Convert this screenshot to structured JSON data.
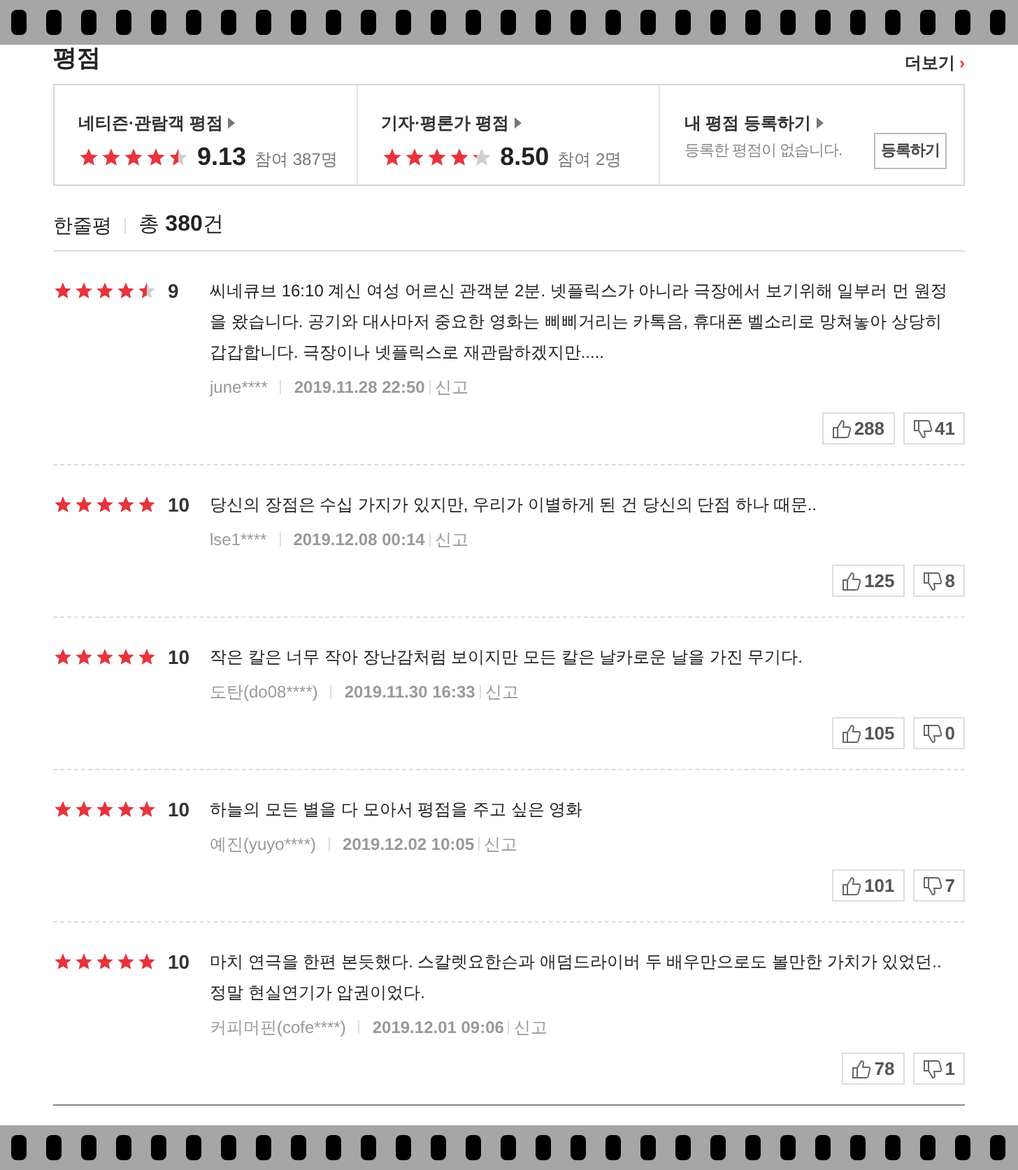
{
  "section_title": "평점",
  "more_link": "더보기",
  "more_arrow": "›",
  "summary": [
    {
      "kind": "score",
      "label": "네티즌·관람객 평점",
      "stars": 4.5,
      "score": "9.13",
      "participants": "참여 387명"
    },
    {
      "kind": "score",
      "label": "기자·평론가 평점",
      "stars": 4.25,
      "score": "8.50",
      "participants": "참여 2명"
    },
    {
      "kind": "register",
      "label": "내 평점 등록하기",
      "message": "등록한 평점이 없습니다.",
      "button": "등록하기"
    }
  ],
  "reviews_header": {
    "title": "한줄평",
    "total_prefix": "총",
    "total_count": "380",
    "total_suffix": "건"
  },
  "reviews": [
    {
      "stars": 4.5,
      "score": "9",
      "text": "씨네큐브 16:10 계신 여성 어르신 관객분 2분. 넷플릭스가 아니라 극장에서 보기위해 일부러 먼 원정을 왔습니다. 공기와 대사마저 중요한 영화는 삐삐거리는 카톡음, 휴대폰 벨소리로 망쳐놓아 상당히 갑갑합니다. 극장이나 넷플릭스로 재관람하겠지만.....",
      "author": "june****",
      "date": "2019.11.28 22:50",
      "report": "신고",
      "likes": "288",
      "dislikes": "41"
    },
    {
      "stars": 5,
      "score": "10",
      "text": "당신의 장점은 수십 가지가 있지만, 우리가 이별하게 된 건 당신의 단점 하나 때문..",
      "author": "lse1****",
      "date": "2019.12.08 00:14",
      "report": "신고",
      "likes": "125",
      "dislikes": "8"
    },
    {
      "stars": 5,
      "score": "10",
      "text": "작은 칼은 너무 작아 장난감처럼 보이지만 모든 칼은 날카로운 날을 가진 무기다.",
      "author": "도탄(do08****)",
      "date": "2019.11.30 16:33",
      "report": "신고",
      "likes": "105",
      "dislikes": "0"
    },
    {
      "stars": 5,
      "score": "10",
      "text": "하늘의 모든 별을 다 모아서 평점을 주고 싶은 영화",
      "author": "예진(yuyo****)",
      "date": "2019.12.02 10:05",
      "report": "신고",
      "likes": "101",
      "dislikes": "7"
    },
    {
      "stars": 5,
      "score": "10",
      "text": "마치 연극을 한편 본듯했다. 스칼렛요한슨과 애덤드라이버 두 배우만으로도 볼만한 가치가 있었던.. 정말 현실연기가 압권이었다.",
      "author": "커피머핀(cofe****)",
      "date": "2019.12.01 09:06",
      "report": "신고",
      "likes": "78",
      "dislikes": "1"
    }
  ]
}
